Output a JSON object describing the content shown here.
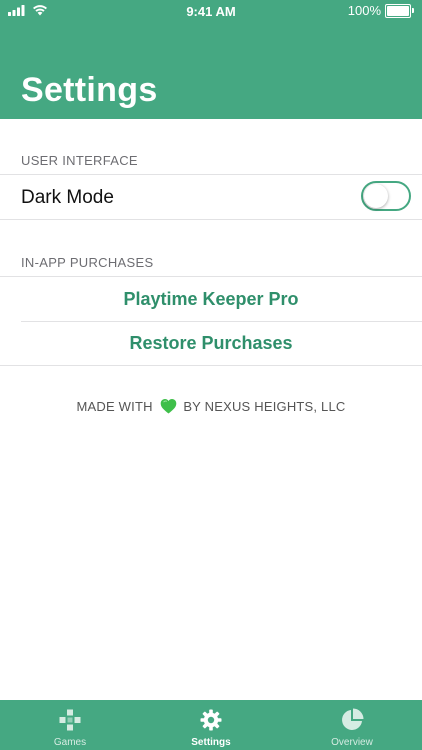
{
  "status_bar": {
    "time": "9:41 AM",
    "battery_percent": "100%",
    "battery_level": 1.0
  },
  "page_title": "Settings",
  "sections": {
    "user_interface": {
      "header": "USER INTERFACE",
      "dark_mode": {
        "label": "Dark Mode",
        "enabled": false
      }
    },
    "purchases": {
      "header": "IN-APP PURCHASES",
      "items": [
        {
          "label": "Playtime Keeper Pro"
        },
        {
          "label": "Restore Purchases"
        }
      ]
    }
  },
  "footer": {
    "made_with": "MADE WITH",
    "by": "BY NEXUS HEIGHTS, LLC",
    "heart_icon": "green-heart-icon"
  },
  "tab_bar": {
    "active": "settings",
    "tabs": [
      {
        "id": "games",
        "label": "Games",
        "icon": "gamepad-icon"
      },
      {
        "id": "settings",
        "label": "Settings",
        "icon": "gear-icon"
      },
      {
        "id": "overview",
        "label": "Overview",
        "icon": "pie-chart-icon"
      }
    ]
  },
  "colors": {
    "brand": "#45a882",
    "action_text": "#2f8f6b",
    "heart": "#3fbf4a"
  }
}
